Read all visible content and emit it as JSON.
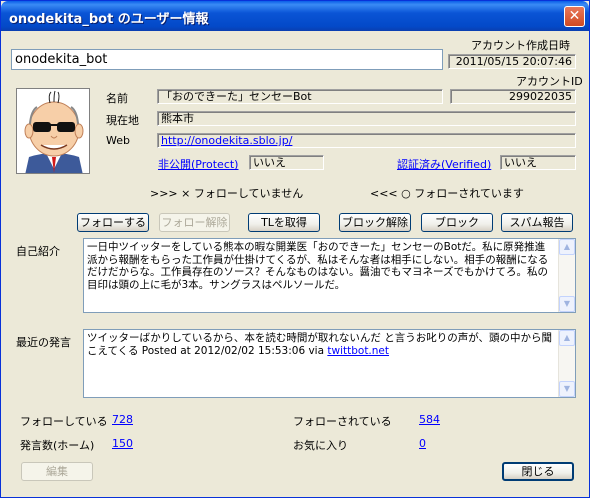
{
  "window": {
    "title": "onodekita_bot  のユーザー情報",
    "close_glyph": "✕"
  },
  "account": {
    "created_label": "アカウント作成日時",
    "created_value": "2011/05/15 20:07:46",
    "screen_name": "onodekita_bot",
    "id_label": "アカウントID",
    "id_value": "299022035"
  },
  "profile": {
    "name_label": "名前",
    "name_value": "「おのできーた」センセーBot",
    "location_label": "現在地",
    "location_value": "熊本市",
    "web_label": "Web",
    "web_value": "http://onodekita.sblo.jp/",
    "protect_label": "非公開(Protect)",
    "protect_value": "いいえ",
    "verified_label": "認証済み(Verified)",
    "verified_value": "いいえ"
  },
  "follow_status": {
    "following": ">>> × フォローしていません",
    "followed": "<<< ○ フォローされています"
  },
  "actions": {
    "follow": "フォローする",
    "unfollow": "フォロー解除",
    "get_tl": "TLを取得",
    "unblock": "ブロック解除",
    "block": "ブロック",
    "report_spam": "スパム報告"
  },
  "bio": {
    "label": "自己紹介",
    "text": "一日中ツイッターをしている熊本の暇な開業医「おのできーた」センセーのBotだ。私に原発推進派から報酬をもらった工作員が仕掛けてくるが、私はそんな者は相手にしない。相手の報酬になるだけだからな。工作員存在のソース？そんなものはない。醤油でもマヨネーズでもかけてろ。私の目印は頭の上に毛が3本。サングラスはペルソールだ。"
  },
  "recent": {
    "label": "最近の発言",
    "text": "ツイッターばかりしているから、本を読む時間が取れないんだ と言うお叱りの声が、頭の中から聞こえてくる Posted at 2012/02/02 15:53:06 via ",
    "via_link": "twittbot.net"
  },
  "stats": {
    "following_label": "フォローしている",
    "following_value": "728",
    "followers_label": "フォローされている",
    "followers_value": "584",
    "tweets_label": "発言数(ホーム)",
    "tweets_value": "150",
    "favorites_label": "お気に入り",
    "favorites_value": "0"
  },
  "footer": {
    "edit": "編集",
    "close": "閉じる"
  }
}
